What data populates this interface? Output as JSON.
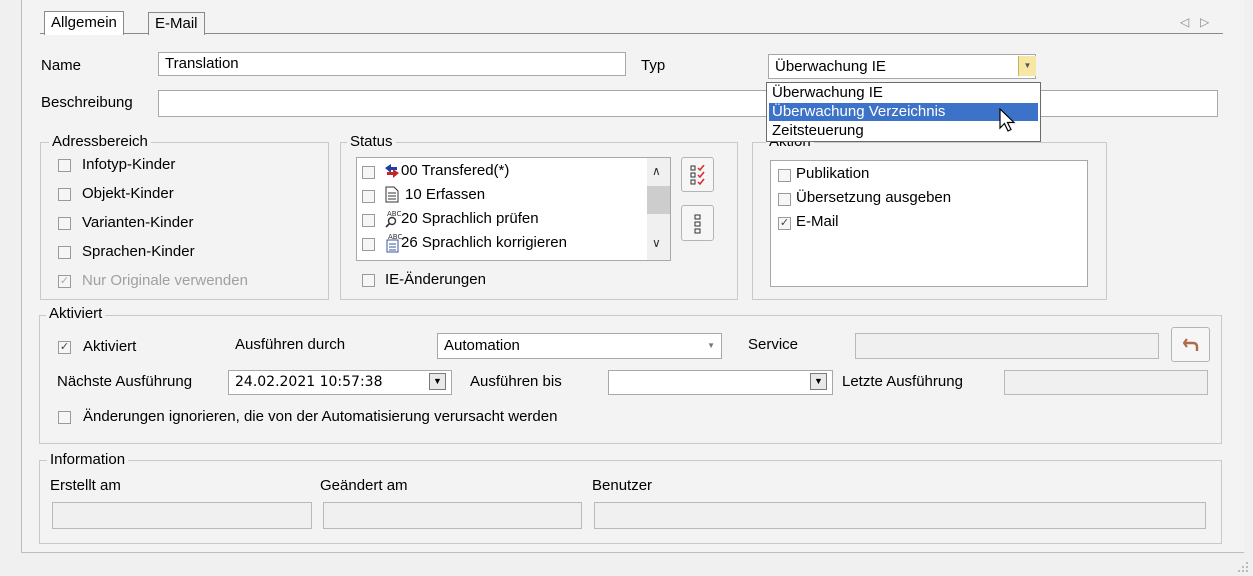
{
  "tabs": [
    {
      "label": "Allgemein",
      "active": true
    },
    {
      "label": "E-Mail",
      "active": false
    }
  ],
  "nav_arrows": {
    "left": "◁",
    "right": "▷"
  },
  "name": {
    "label": "Name",
    "value": "Translation"
  },
  "typ": {
    "label": "Typ",
    "selected": "Überwachung IE",
    "options": [
      "Überwachung IE",
      "Überwachung Verzeichnis",
      "Zeitsteuerung"
    ],
    "highlighted": "Überwachung Verzeichnis"
  },
  "beschreibung": {
    "label": "Beschreibung",
    "value": ""
  },
  "adressbereich": {
    "title": "Adressbereich",
    "items": [
      {
        "label": "Infotyp-Kinder",
        "checked": false,
        "disabled": false
      },
      {
        "label": "Objekt-Kinder",
        "checked": false,
        "disabled": false
      },
      {
        "label": "Varianten-Kinder",
        "checked": false,
        "disabled": false
      },
      {
        "label": "Sprachen-Kinder",
        "checked": false,
        "disabled": false
      },
      {
        "label": "Nur Originale verwenden",
        "checked": true,
        "disabled": true
      }
    ]
  },
  "status": {
    "title": "Status",
    "items": [
      {
        "label": "00 Transfered(*)",
        "icon": "transfer-arrows-icon"
      },
      {
        "label": "10 Erfassen",
        "icon": "document-icon"
      },
      {
        "label": "20 Sprachlich prüfen",
        "icon": "spellcheck-icon"
      },
      {
        "label": "26 Sprachlich korrigieren",
        "icon": "spellcheck-doc-icon"
      }
    ],
    "ie_aenderungen": "IE-Änderungen"
  },
  "aktion": {
    "title": "Aktion",
    "items": [
      {
        "label": "Publikation",
        "checked": false
      },
      {
        "label": "Übersetzung ausgeben",
        "checked": false
      },
      {
        "label": "E-Mail",
        "checked": true
      }
    ]
  },
  "aktiviert": {
    "title": "Aktiviert",
    "checkbox_label": "Aktiviert",
    "checked": true,
    "ausfuehren_durch_label": "Ausführen durch",
    "ausfuehren_durch_value": "Automation",
    "service_label": "Service",
    "service_value": "",
    "naechste_label": "Nächste Ausführung",
    "naechste_value": "24.02.2021 10:57:38",
    "bis_label": "Ausführen bis",
    "bis_value": "",
    "letzte_label": "Letzte Ausführung",
    "letzte_value": "",
    "ignore_label": "Änderungen ignorieren, die von der Automatisierung verursacht werden"
  },
  "information": {
    "title": "Information",
    "erstellt_label": "Erstellt am",
    "geaendert_label": "Geändert am",
    "benutzer_label": "Benutzer"
  },
  "colors": {
    "selection": "#3c73c8",
    "reset_icon": "#b06a4a",
    "checklist_icon": "#d62a2a"
  }
}
